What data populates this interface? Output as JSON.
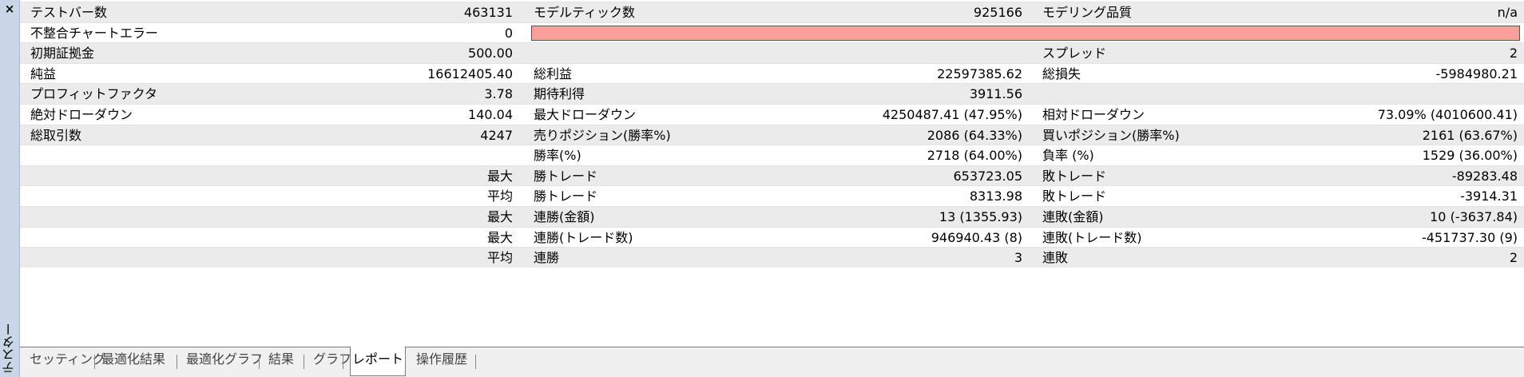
{
  "panel": {
    "title": "テスター",
    "close_icon": "×"
  },
  "rows": [
    {
      "shade": true,
      "c1": "テストバー数",
      "c2": "463131",
      "c3": "モデルティック数",
      "c4": "925166",
      "c5": "モデリング品質",
      "c6": "n/a"
    },
    {
      "shade": false,
      "c1": "不整合チャートエラー",
      "c2": "0",
      "error_bar": true
    },
    {
      "shade": true,
      "c1": "初期証拠金",
      "c2": "500.00",
      "c3": "",
      "c4": "",
      "c5": "スプレッド",
      "c6": "2"
    },
    {
      "shade": false,
      "c1": "純益",
      "c2": "16612405.40",
      "c3": "総利益",
      "c4": "22597385.62",
      "c5": "総損失",
      "c6": "-5984980.21"
    },
    {
      "shade": true,
      "c1": "プロフィットファクタ",
      "c2": "3.78",
      "c3": "期待利得",
      "c4": "3911.56",
      "c5": "",
      "c6": ""
    },
    {
      "shade": false,
      "c1": "絶対ドローダウン",
      "c2": "140.04",
      "c3": "最大ドローダウン",
      "c4": "4250487.41 (47.95%)",
      "c5": "相対ドローダウン",
      "c6": "73.09% (4010600.41)"
    },
    {
      "shade": true,
      "c1": "総取引数",
      "c2": "4247",
      "c3": "売りポジション(勝率%)",
      "c4": "2086 (64.33%)",
      "c5": "買いポジション(勝率%)",
      "c6": "2161 (63.67%)"
    },
    {
      "shade": false,
      "c1": "",
      "c2": "",
      "c3": "勝率(%)",
      "c4": "2718 (64.00%)",
      "c5": "負率 (%)",
      "c6": "1529 (36.00%)"
    },
    {
      "shade": true,
      "c1": "",
      "c2": "最大",
      "c3": "勝トレード",
      "c4": "653723.05",
      "c5": "敗トレード",
      "c6": "-89283.48"
    },
    {
      "shade": false,
      "c1": "",
      "c2": "平均",
      "c3": "勝トレード",
      "c4": "8313.98",
      "c5": "敗トレード",
      "c6": "-3914.31"
    },
    {
      "shade": true,
      "c1": "",
      "c2": "最大",
      "c3": "連勝(金額)",
      "c4": "13 (1355.93)",
      "c5": "連敗(金額)",
      "c6": "10 (-3637.84)"
    },
    {
      "shade": false,
      "c1": "",
      "c2": "最大",
      "c3": "連勝(トレード数)",
      "c4": "946940.43 (8)",
      "c5": "連敗(トレード数)",
      "c6": "-451737.30 (9)"
    },
    {
      "shade": true,
      "c1": "",
      "c2": "平均",
      "c3": "連勝",
      "c4": "3",
      "c5": "連敗",
      "c6": "2"
    }
  ],
  "tabs": [
    {
      "label": "セッティング",
      "active": false
    },
    {
      "label": "最適化結果",
      "active": false
    },
    {
      "label": "最適化グラフ",
      "active": false
    },
    {
      "label": "結果",
      "active": false
    },
    {
      "label": "グラフ",
      "active": false
    },
    {
      "label": "レポート",
      "active": true
    },
    {
      "label": "操作履歴",
      "active": false
    }
  ],
  "colors": {
    "error_bar": "#f9a09b",
    "side_panel": "#c9d6e8"
  }
}
